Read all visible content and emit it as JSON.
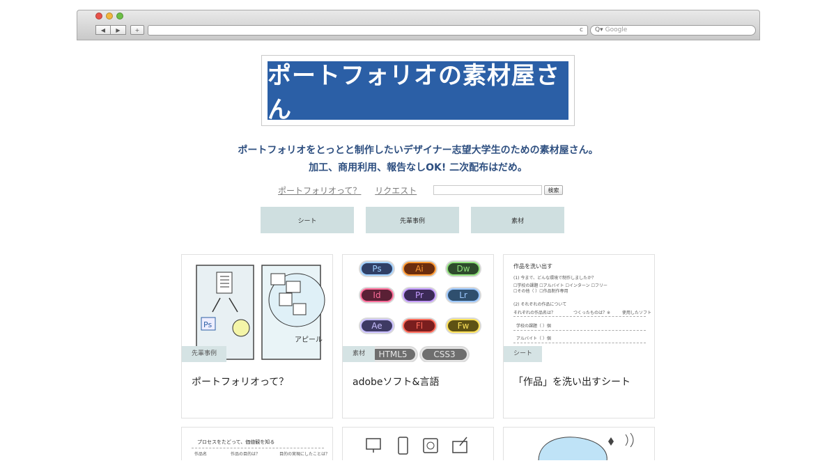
{
  "browser": {
    "search_placeholder": "Google",
    "back_glyph": "◀",
    "forward_glyph": "▶",
    "newtab_glyph": "+",
    "reload_glyph": "c"
  },
  "site": {
    "logo_text": "ポートフォリオの素材屋さん",
    "tagline1": "ポートフォリオをとっとと制作したいデザイナー志望大学生のための素材屋さん。",
    "tagline2": "加工、商用利用、報告なしOK!  二次配布はだめ。",
    "nav_link1": "ポートフォリオって？",
    "nav_link2": "リクエスト",
    "search_button": "検索"
  },
  "categories": [
    "シート",
    "先輩事例",
    "素材"
  ],
  "cards": [
    {
      "badge": "先輩事例",
      "title": "ポートフォリオって？"
    },
    {
      "badge": "素材",
      "title": "adobeソフト&言語"
    },
    {
      "badge": "シート",
      "title": "「作品」を洗い出すシート"
    }
  ],
  "card1_art": {
    "ps": "Ps",
    "appeal": "アピール"
  },
  "adobe_pills": [
    {
      "label": "Ps",
      "bg": "#2f3f66",
      "fg": "#9fd0ff"
    },
    {
      "label": "Ai",
      "bg": "#6b2d0e",
      "fg": "#ff9a33"
    },
    {
      "label": "Dw",
      "bg": "#2e4a2c",
      "fg": "#8fe07a"
    },
    {
      "label": "Id",
      "bg": "#5a2035",
      "fg": "#ff6d9a"
    },
    {
      "label": "Pr",
      "bg": "#3b2a57",
      "fg": "#c49cff"
    },
    {
      "label": "Lr",
      "bg": "#2f4f6e",
      "fg": "#9cc8ff"
    },
    {
      "label": "Ae",
      "bg": "#3e3a63",
      "fg": "#c9bfff"
    },
    {
      "label": "Fl",
      "bg": "#7a1e1e",
      "fg": "#ff6b5a"
    },
    {
      "label": "Fw",
      "bg": "#5e5214",
      "fg": "#ffe35a"
    },
    {
      "label": "HTML5",
      "bg": "#6e6e6e",
      "fg": "#e6e6e6"
    },
    {
      "label": "CSS3",
      "bg": "#6e6e6e",
      "fg": "#e6e6e6"
    }
  ],
  "sheet": {
    "title": "作品を洗い出す",
    "q1": "(1) 今まで、どんな環境で制作しましたか？",
    "opts1": "☐学校の課題  ☐アルバイト  ☐インターン  ☐フリー",
    "opts2": "☐その他（                    ）☐作品制作専用",
    "q2": "(2) それぞれの作品について",
    "col1": "それぞれの作品名は？",
    "col2": "つくったものは？※",
    "col3": "使用したソフト",
    "row1": "学校の課題（    ）個",
    "row2": "アルバイト（    ）個"
  },
  "row2": {
    "sheet_title": "プロセスをたどって、価値観を知る",
    "col1": "作品名",
    "col2": "作品の目的は？",
    "col3": "目的の実現にしたことは？"
  }
}
